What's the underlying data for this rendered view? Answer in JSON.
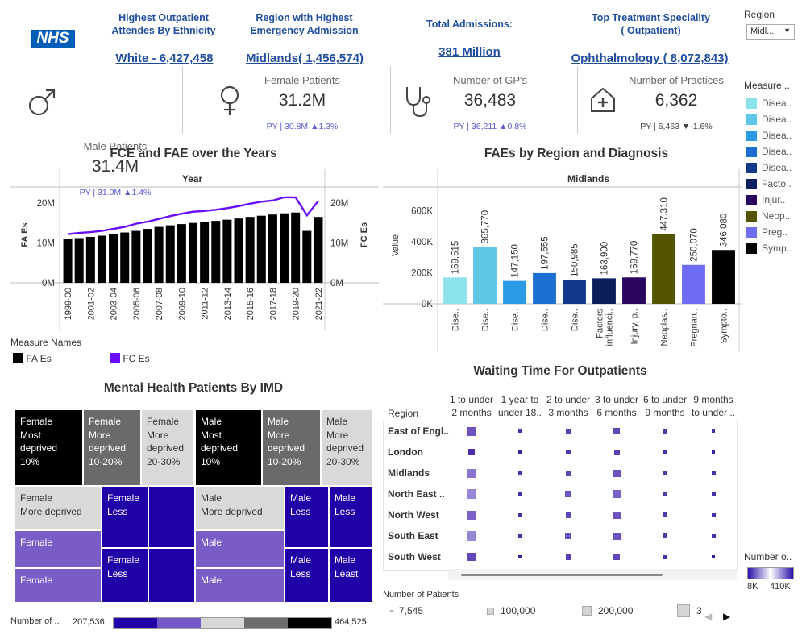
{
  "logo": "NHS",
  "header": {
    "ethnicity": {
      "title1": "Highest Outpatient",
      "title2": "Attendes By Ethnicity",
      "value": "White - 6,427,458"
    },
    "region": {
      "title1": "Region with HIghest",
      "title2": "Emergency Admission",
      "value": "Midlands( 1,456,574)"
    },
    "admissions": {
      "title1": "Total Admissions:",
      "value": "381 Million"
    },
    "speciality": {
      "title1": "Top Treatment Speciality",
      "title2": "( Outpatient)",
      "value": "Ophthalmology ( 8,072,843)"
    }
  },
  "filters": {
    "region_label": "Region",
    "region_value": "Midl..."
  },
  "kpis": [
    {
      "label": "Male Patients",
      "value": "31.4M",
      "py": "PY | 31.0M ▲1.4%"
    },
    {
      "label": "Female Patients",
      "value": "31.2M",
      "py": "PY | 30.8M ▲1.3%"
    },
    {
      "label": "Number of GP's",
      "value": "36,483",
      "py": "PY | 36,211 ▲0.8%"
    },
    {
      "label": "Number of Practices",
      "value": "6,362",
      "py": "PY | 6,463 ▼-1.6%"
    }
  ],
  "measure_legend": {
    "title": "Measure ..",
    "items": [
      {
        "label": "Disea..",
        "color": "#8de3ea"
      },
      {
        "label": "Disea..",
        "color": "#5fc6e8"
      },
      {
        "label": "Disea..",
        "color": "#2b9be6"
      },
      {
        "label": "Disea..",
        "color": "#1a6fd0"
      },
      {
        "label": "Disea..",
        "color": "#12388c"
      },
      {
        "label": "Facto..",
        "color": "#0a1f5c"
      },
      {
        "label": "Injur..",
        "color": "#2a0660"
      },
      {
        "label": "Neop..",
        "color": "#545400"
      },
      {
        "label": "Preg..",
        "color": "#6e6cf2"
      },
      {
        "label": "Symp..",
        "color": "#000000"
      }
    ]
  },
  "fce": {
    "title": "FCE and FAE over the Years",
    "header": "Year",
    "ylabel_left": "FA Es",
    "ylabel_right": "FC Es",
    "yticks": [
      "20M",
      "10M",
      "0M"
    ],
    "legend_title": "Measure Names",
    "legend": [
      {
        "label": "FA Es",
        "color": "#000000"
      },
      {
        "label": "FC Es",
        "color": "#6a0dff"
      }
    ]
  },
  "faes": {
    "title": "FAEs by Region and Diagnosis",
    "header": "Midlands",
    "ylabel": "Value",
    "yticks": [
      "600K",
      "400K",
      "200K",
      "0K"
    ]
  },
  "treemap": {
    "title": "Mental Health Patients By IMD",
    "cells": [
      {
        "text": "Female\nMost\ndeprived\n10%"
      },
      {
        "text": "Female\nMore\ndeprived\n10-20%"
      },
      {
        "text": "Female\nMore\ndeprived\n20-30%"
      },
      {
        "text": "Male\nMost\ndeprived\n10%"
      },
      {
        "text": "Male\nMore\ndeprived\n10-20%"
      },
      {
        "text": "Male\nMore\ndeprived\n20-30%"
      },
      {
        "text": "Female\nMore deprived"
      },
      {
        "text": "Female\nLess"
      },
      {
        "text": "Male\nMore deprived"
      },
      {
        "text": "Male\nLess"
      },
      {
        "text": "Male\nLess"
      },
      {
        "text": "Female"
      },
      {
        "text": "Male"
      },
      {
        "text": "Female\nLess"
      },
      {
        "text": "Male\nLess"
      },
      {
        "text": "Male\nLeast"
      },
      {
        "text": "Female"
      },
      {
        "text": "Male"
      }
    ],
    "legend_label": "Number of ..",
    "legend_min": "207,536",
    "legend_max": "464,525"
  },
  "waiting": {
    "title": "Waiting Time For Outpatients",
    "region_label": "Region",
    "columns": [
      [
        "1 to under",
        "2 months"
      ],
      [
        "1 year to",
        "under 18.."
      ],
      [
        "2 to under",
        "3 months"
      ],
      [
        "3 to under",
        "6 months"
      ],
      [
        "6 to under",
        "9 months"
      ],
      [
        "9 months",
        "to under .."
      ]
    ],
    "regions": [
      "East of Engl..",
      "London",
      "Midlands",
      "North East ..",
      "North West",
      "South East",
      "South West"
    ],
    "sizes": [
      [
        11,
        4,
        6,
        8,
        5,
        4
      ],
      [
        8,
        4,
        6,
        7,
        5,
        4
      ],
      [
        11,
        5,
        7,
        9,
        6,
        5
      ],
      [
        12,
        5,
        8,
        10,
        6,
        5
      ],
      [
        11,
        5,
        7,
        9,
        6,
        5
      ],
      [
        12,
        5,
        8,
        9,
        6,
        5
      ],
      [
        10,
        4,
        7,
        8,
        5,
        4
      ]
    ],
    "shades": [
      [
        "#6f52c2",
        "#4a2fa8",
        "#5b3fb0",
        "#6146b8",
        "#5136ad",
        "#4a2fa8"
      ],
      [
        "#4a2fa8",
        "#3d1fa0",
        "#5136ad",
        "#5b3fb0",
        "#4a2fa8",
        "#3d1fa0"
      ],
      [
        "#8b74d0",
        "#4a2fa8",
        "#6146b8",
        "#6f52c2",
        "#5136ad",
        "#4a2fa8"
      ],
      [
        "#9a86d6",
        "#4a2fa8",
        "#6f52c2",
        "#7a62c8",
        "#5136ad",
        "#4a2fa8"
      ],
      [
        "#7a62c8",
        "#4a2fa8",
        "#6146b8",
        "#6f52c2",
        "#5136ad",
        "#4a2fa8"
      ],
      [
        "#9a86d6",
        "#4a2fa8",
        "#6f52c2",
        "#6f52c2",
        "#5136ad",
        "#4a2fa8"
      ],
      [
        "#6146b8",
        "#3d1fa0",
        "#5b3fb0",
        "#6146b8",
        "#4a2fa8",
        "#3d1fa0"
      ]
    ],
    "size_legend_title": "Number of Patients",
    "size_legend": [
      "7,545",
      "100,000",
      "200,000",
      "3"
    ],
    "color_legend_title": "Number o..",
    "color_legend_min": "8K",
    "color_legend_max": "410K"
  },
  "chart_data": [
    {
      "type": "bar",
      "title": "FCE and FAE over the Years",
      "xlabel": "Year",
      "ylabel": "FA Es",
      "y2label": "FC Es",
      "ylim": [
        0,
        24000000
      ],
      "categories": [
        "1999-00",
        "2000-01",
        "2001-02",
        "2002-03",
        "2003-04",
        "2004-05",
        "2005-06",
        "2006-07",
        "2007-08",
        "2008-09",
        "2009-10",
        "2010-11",
        "2011-12",
        "2012-13",
        "2013-14",
        "2014-15",
        "2015-16",
        "2016-17",
        "2017-18",
        "2018-19",
        "2019-20",
        "2020-21",
        "2021-22"
      ],
      "tick_labels": [
        "1999-00",
        "2001-02",
        "2003-04",
        "2005-06",
        "2007-08",
        "2009-10",
        "2011-12",
        "2013-14",
        "2015-16",
        "2017-18",
        "2019-20",
        "2021-22"
      ],
      "series": [
        {
          "name": "FA Es",
          "type": "bar",
          "values": [
            11.0,
            11.2,
            11.5,
            11.8,
            12.2,
            12.6,
            13.0,
            13.5,
            14.0,
            14.4,
            14.7,
            15.0,
            15.2,
            15.5,
            15.8,
            16.1,
            16.5,
            16.8,
            17.1,
            17.4,
            17.6,
            13.0,
            16.5
          ]
        },
        {
          "name": "FC Es",
          "type": "line",
          "values": [
            12.2,
            12.5,
            12.7,
            13.0,
            13.5,
            14.0,
            14.8,
            15.3,
            16.0,
            16.7,
            17.3,
            17.8,
            18.0,
            18.3,
            18.7,
            19.2,
            19.8,
            20.3,
            20.6,
            21.4,
            21.4,
            16.9,
            20.5
          ]
        }
      ]
    },
    {
      "type": "bar",
      "title": "FAEs by Region and Diagnosis",
      "xlabel": "Midlands",
      "ylabel": "Value",
      "ylim": [
        0,
        700000
      ],
      "categories": [
        "Dise..",
        "Dise..",
        "Dise..",
        "Dise..",
        "Dise..",
        "Factors influenci..",
        "Injury, p..",
        "Neoplas..",
        "Pregnan..",
        "Sympto.."
      ],
      "values": [
        169515,
        365770,
        147150,
        197555,
        150985,
        163900,
        169770,
        447310,
        250070,
        346080
      ],
      "value_labels": [
        "169,515",
        "365,770",
        "147,150",
        "197,555",
        "150,985",
        "163,900",
        "169,770",
        "447,310",
        "250,070",
        "346,080"
      ],
      "colors": [
        "#8de3ea",
        "#5fc6e8",
        "#2b9be6",
        "#1a6fd0",
        "#12388c",
        "#0a1f5c",
        "#2a0660",
        "#545400",
        "#6e6cf2",
        "#000000"
      ]
    }
  ]
}
